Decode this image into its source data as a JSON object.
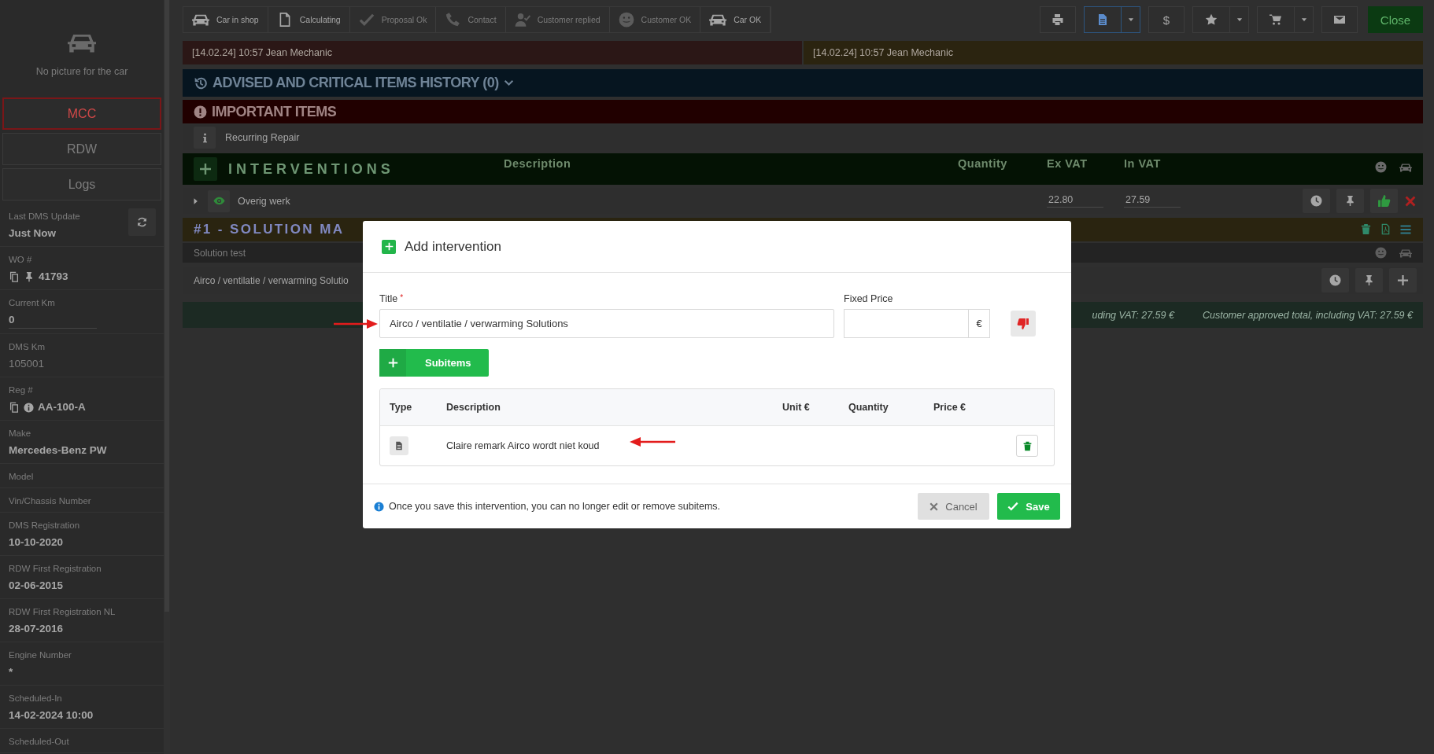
{
  "sidebar": {
    "no_picture": "No picture for the car",
    "tabs": [
      {
        "label": "MCC",
        "selected": true
      },
      {
        "label": "RDW",
        "selected": false
      },
      {
        "label": "Logs",
        "selected": false
      }
    ],
    "fields": [
      {
        "kind": "refresh",
        "label": "Last DMS Update",
        "value": "Just Now"
      },
      {
        "kind": "work-order",
        "label": "WO #",
        "value": "41793"
      },
      {
        "kind": "input",
        "label": "Current Km",
        "value": "0"
      },
      {
        "kind": "muted",
        "label": "DMS Km",
        "value": "105001"
      },
      {
        "kind": "registration",
        "label": "Reg #",
        "value": "AA-100-A"
      },
      {
        "kind": "plain",
        "label": "Make",
        "value": "Mercedes-Benz PW"
      },
      {
        "kind": "plain",
        "label": "Model"
      },
      {
        "kind": "plain",
        "label": "Vin/Chassis Number"
      },
      {
        "kind": "plain",
        "label": "DMS Registration",
        "value": "10-10-2020"
      },
      {
        "kind": "plain",
        "label": "RDW First Registration",
        "value": "02-06-2015"
      },
      {
        "kind": "plain",
        "label": "RDW First Registration NL",
        "value": "28-07-2016"
      },
      {
        "kind": "plain",
        "label": "Engine Number",
        "value": "*"
      },
      {
        "kind": "plain",
        "label": "Scheduled-In",
        "value": "14-02-2024 10:00"
      },
      {
        "kind": "plain",
        "label": "Scheduled-Out"
      }
    ]
  },
  "toolbar": {
    "steps": [
      {
        "kind": "car",
        "label": "Car in shop",
        "done": true
      },
      {
        "kind": "document",
        "label": "Calculating",
        "done": true
      },
      {
        "kind": "check",
        "label": "Proposal Ok",
        "done": false
      },
      {
        "kind": "phone",
        "label": "Contact",
        "done": false
      },
      {
        "kind": "user-check",
        "label": "Customer replied",
        "done": false
      },
      {
        "kind": "smiley",
        "label": "Customer OK",
        "done": false
      },
      {
        "kind": "car",
        "label": "Car OK",
        "done": true
      }
    ],
    "actions": [
      {
        "kind": "print",
        "dropdown": false,
        "selected": false
      },
      {
        "kind": "document",
        "dropdown": true,
        "selected": true
      },
      {
        "kind": "dollar",
        "label": "$",
        "dropdown": false,
        "selected": false
      },
      {
        "kind": "star",
        "dropdown": true,
        "selected": false
      },
      {
        "kind": "cart",
        "dropdown": true,
        "selected": false
      },
      {
        "kind": "mail",
        "dropdown": false,
        "selected": false
      }
    ],
    "close": "Close"
  },
  "notes": [
    {
      "text": "[14.02.24] 10:57 Jean Mechanic",
      "color": "#2b1716"
    },
    {
      "text": "[14.02.24] 10:57 Jean Mechanic",
      "color": "#2b2410"
    }
  ],
  "advised": {
    "title": "ADVISED AND CRITICAL ITEMS HISTORY (0)"
  },
  "important": {
    "title": "IMPORTANT ITEMS",
    "items": [
      "Recurring Repair"
    ]
  },
  "interventions": {
    "title": "INTERVENTIONS",
    "columns": [
      "Description",
      "Quantity",
      "Ex VAT",
      "In VAT"
    ],
    "rows": [
      {
        "title": "Overig werk",
        "ex_vat": "22.80",
        "in_vat": "27.59",
        "approved": true
      }
    ]
  },
  "solution": {
    "title": "#1 - SOLUTION MA",
    "subtitle": "Solution test",
    "item": "Airco / ventilatie / verwarming Solutio",
    "totals": [
      "uding VAT: 27.59 €",
      "Customer approved total, including VAT: 27.59 €"
    ]
  },
  "modal": {
    "title": "Add intervention",
    "title_label": "Title",
    "required": true,
    "title_value": "Airco / ventilatie / verwarming Solutions",
    "price_label": "Fixed Price",
    "currency": "€",
    "subitems_button": "Subitems",
    "columns": [
      "Type",
      "Description",
      "Unit €",
      "Quantity",
      "Price €"
    ],
    "rows": [
      {
        "description": "Claire remark Airco wordt niet koud"
      }
    ],
    "note": "Once you save this intervention, you can no longer edit or remove subitems.",
    "cancel": "Cancel",
    "save": "Save"
  }
}
